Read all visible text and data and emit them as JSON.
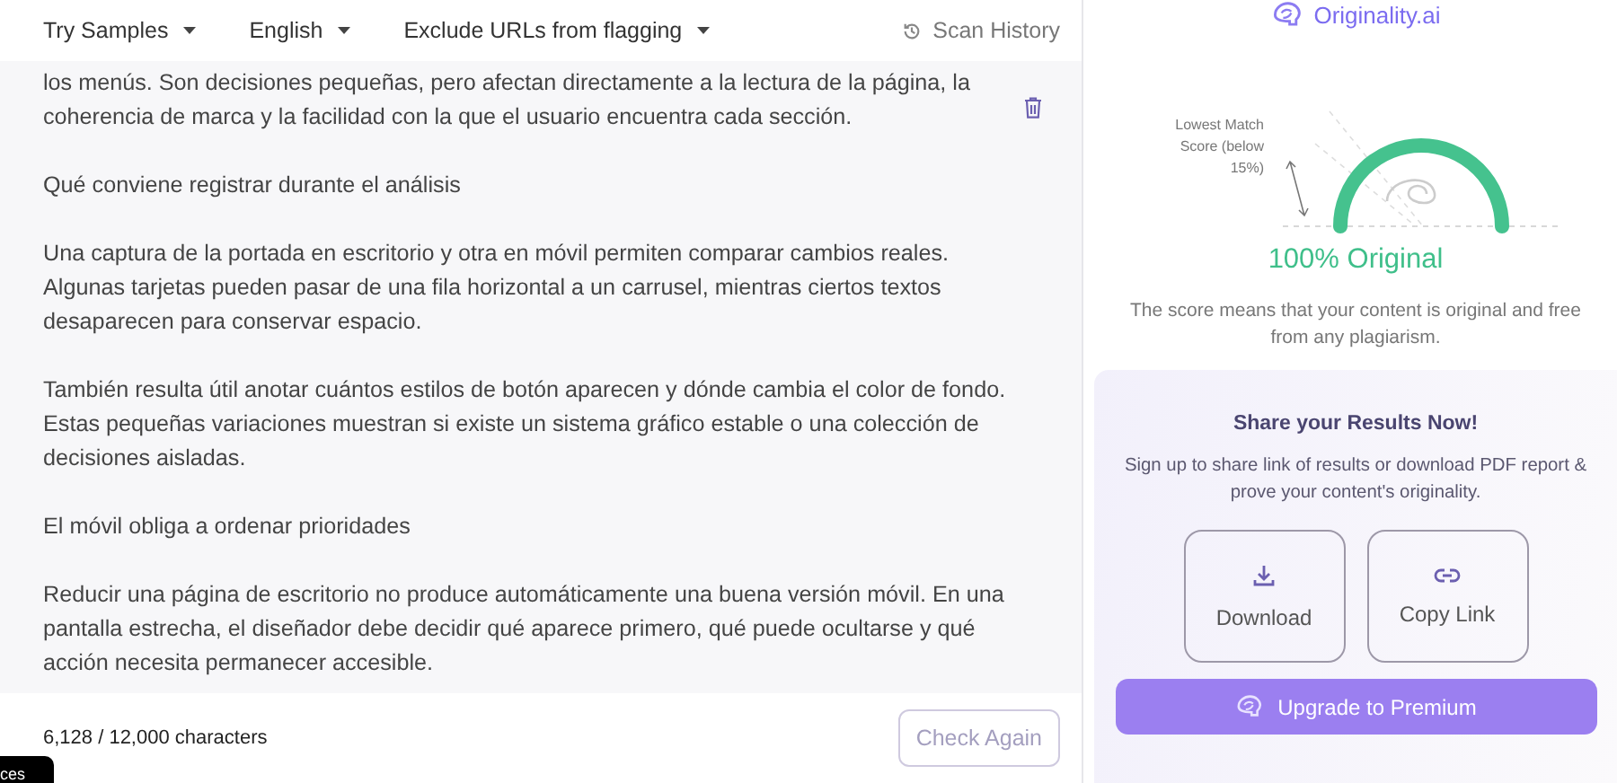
{
  "toolbar": {
    "dropdowns": [
      "Try Samples",
      "English",
      "Exclude URLs from flagging"
    ],
    "history": "Scan History"
  },
  "editor": {
    "paragraphs": [
      "los menús. Son decisiones pequeñas, pero afectan directamente a la lectura de la página, la coherencia de marca y la facilidad con la que el usuario encuentra cada sección.",
      "Qué conviene registrar durante el análisis",
      "Una captura de la portada en escritorio y otra en móvil permiten comparar cambios reales. Algunas tarjetas pueden pasar de una fila horizontal a un carrusel, mientras ciertos textos desaparecen para conservar espacio.",
      "También resulta útil anotar cuántos estilos de botón aparecen y dónde cambia el color de fondo. Estas pequeñas variaciones muestran si existe un sistema gráfico estable o una colección de decisiones aisladas.",
      "El móvil obliga a ordenar prioridades",
      "Reducir una página de escritorio no produce automáticamente una buena versión móvil. En una pantalla estrecha, el diseñador debe decidir qué aparece primero, qué puede ocultarse y qué acción necesita permanecer accesible."
    ]
  },
  "footer": {
    "count": "6,128 / 12,000 characters",
    "button": "Check Again",
    "badge": "ces"
  },
  "result": {
    "brand": "Originality.ai",
    "gauge_label": "Lowest Match Score (below 15%)",
    "score": "100% Original",
    "description": "The score means that your content is original and free from any plagiarism."
  },
  "share": {
    "title": "Share your Results Now!",
    "text": "Sign up to share link of results or download PDF report & prove your content's originality.",
    "actions": [
      {
        "kind": "download",
        "label": "Download"
      },
      {
        "kind": "link",
        "label": "Copy Link"
      }
    ],
    "upgrade": "Upgrade to Premium"
  }
}
